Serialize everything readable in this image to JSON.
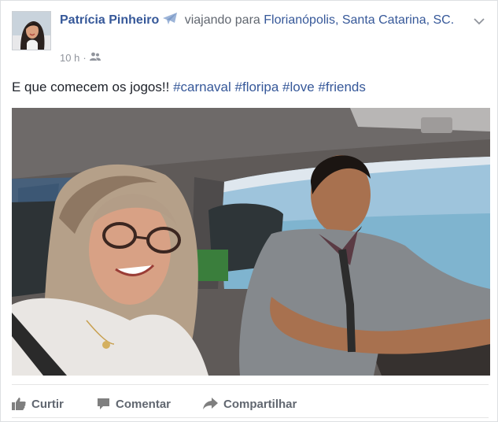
{
  "post": {
    "author": "Patrícia Pinheiro",
    "activity": "viajando para",
    "destination": "Florianópolis, Santa Catarina, SC.",
    "time": "10 h",
    "separator": "·",
    "text": "E que comecem os jogos!!",
    "hashtags": [
      "#carnaval",
      "#floripa",
      "#love",
      "#friends"
    ]
  },
  "actions": {
    "like": "Curtir",
    "comment": "Comentar",
    "share": "Compartilhar"
  },
  "icons": {
    "activity": "airplane-icon",
    "audience": "friends-icon",
    "menu": "chevron-down-icon",
    "like": "thumbs-up-icon",
    "comment": "comment-icon",
    "share": "share-arrow-icon"
  },
  "colors": {
    "link": "#365899",
    "text": "#1d2129",
    "muted": "#90949c",
    "action": "#616770",
    "plane": "#9cb4d8"
  }
}
